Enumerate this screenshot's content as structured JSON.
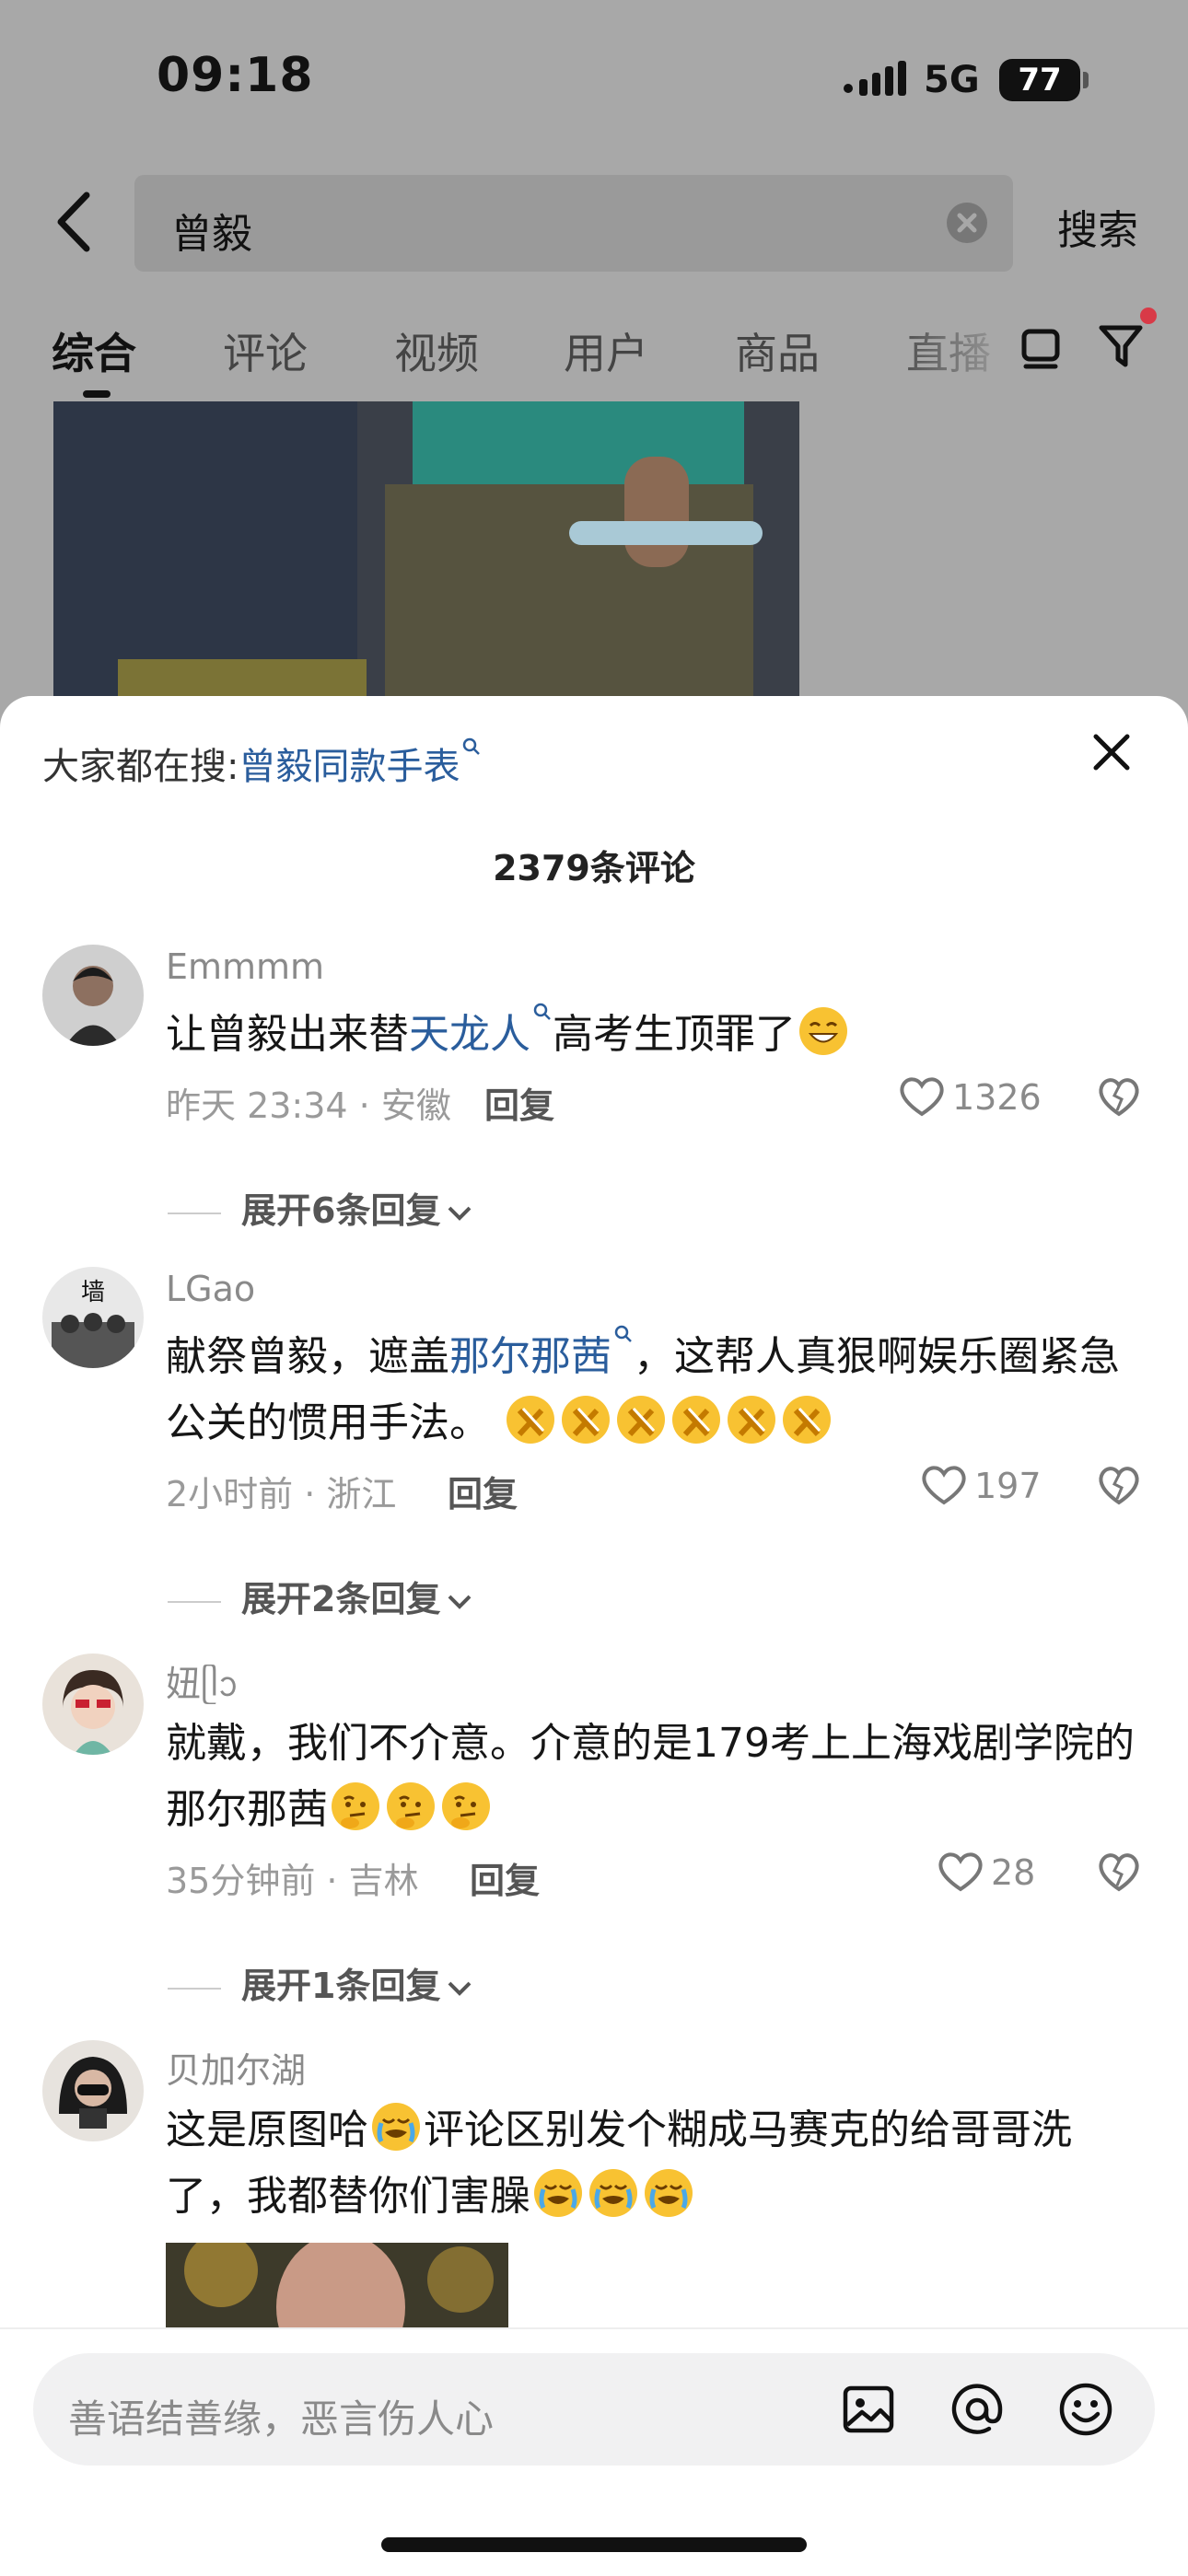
{
  "status_bar": {
    "time": "09:18",
    "network": "5G",
    "battery": "77"
  },
  "search": {
    "query": "曾毅",
    "button": "搜索"
  },
  "tabs": [
    "综合",
    "评论",
    "视频",
    "用户",
    "商品",
    "直播"
  ],
  "sheet": {
    "hot_prefix": "大家都在搜:",
    "hot_link": "曾毅同款手表",
    "comment_count": "2379条评论"
  },
  "comments": [
    {
      "user": "Emmmm",
      "text_before": "让曾毅出来替",
      "link": "天龙人",
      "text_after": "高考生顶罪了",
      "meta": "昨天 23:34 · 安徽",
      "reply": "回复",
      "likes": "1326",
      "expand": "展开6条回复"
    },
    {
      "user": "LGao",
      "text_before": "献祭曾毅，遮盖",
      "link": "那尔那茜",
      "text_after": "，这帮人真狠啊娱乐圈紧急公关的惯用手法。",
      "meta": "2小时前 · 浙江",
      "reply": "回复",
      "likes": "197",
      "expand": "展开2条回复"
    },
    {
      "user": "妞ᥫᩣ",
      "text": "就戴，我们不介意。介意的是179考上上海戏剧学院的那尔那茜",
      "meta": "35分钟前 · 吉林",
      "reply": "回复",
      "likes": "28",
      "expand": "展开1条回复"
    },
    {
      "user": "贝加尔湖",
      "text_before": "这是原图哈",
      "text_after": "评论区别发个糊成马赛克的给哥哥洗了，我都替你们害臊"
    }
  ],
  "input": {
    "placeholder": "善语结善缘，恶言伤人心"
  },
  "icons": [
    "back-icon",
    "clear-icon",
    "list-icon",
    "filter-icon",
    "close-icon",
    "heart-icon",
    "dislike-icon",
    "image-icon",
    "at-icon",
    "emoji-icon"
  ]
}
